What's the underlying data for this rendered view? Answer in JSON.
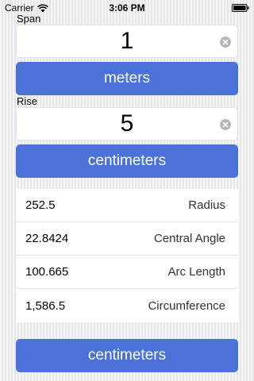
{
  "status_bar": {
    "carrier": "Carrier",
    "time": "3:06 PM"
  },
  "span": {
    "label": "Span",
    "value": "1",
    "unit_button": "meters"
  },
  "rise": {
    "label": "Rise",
    "value": "5",
    "unit_button": "centimeters"
  },
  "results": [
    {
      "value": "252.5",
      "name": "Radius"
    },
    {
      "value": "22.8424",
      "name": "Central Angle"
    },
    {
      "value": "100.665",
      "name": "Arc Length"
    },
    {
      "value": "1,586.5",
      "name": "Circumference"
    }
  ],
  "output_unit_button": "centimeters",
  "colors": {
    "accent": "#4a72d8"
  }
}
